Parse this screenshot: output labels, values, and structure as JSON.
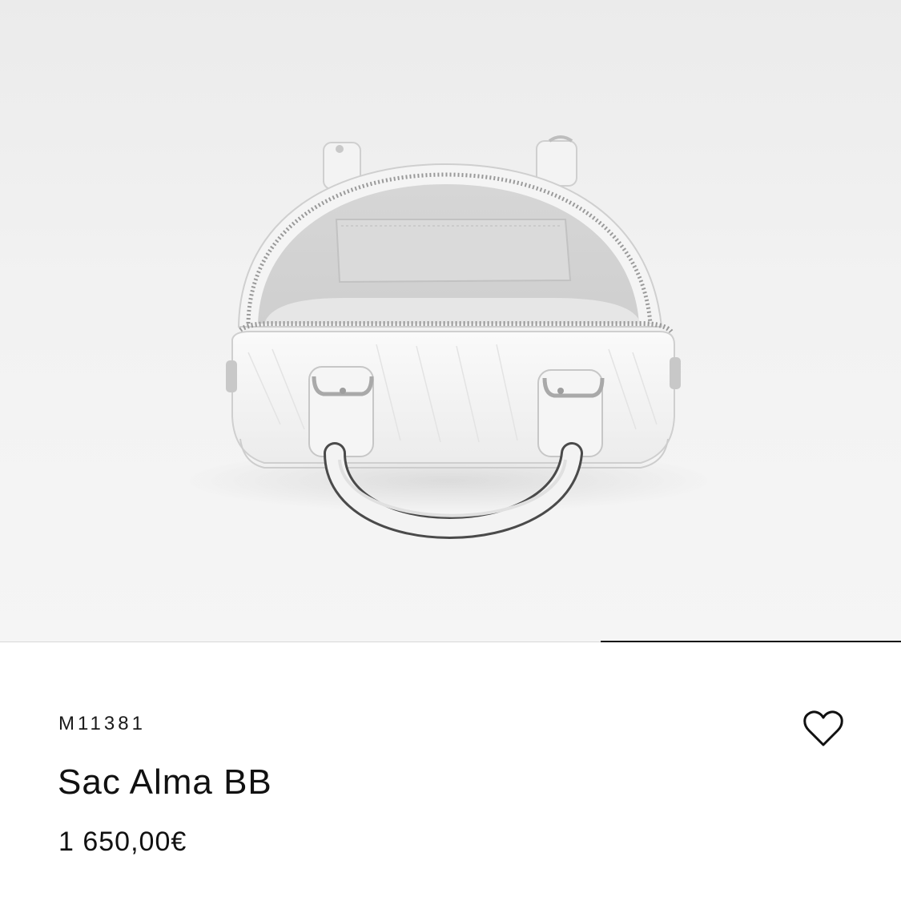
{
  "product": {
    "sku": "M11381",
    "name": "Sac Alma BB",
    "price": "1 650,00€"
  },
  "gallery": {
    "image_icon": "white-handbag-open-top-view",
    "progress": 0.333
  },
  "actions": {
    "wishlist_icon": "heart-outline-icon"
  },
  "colors": {
    "text": "#111111",
    "progress_fill": "#111111",
    "progress_track": "#d9d9d9",
    "image_background": "#f0f0f0"
  }
}
